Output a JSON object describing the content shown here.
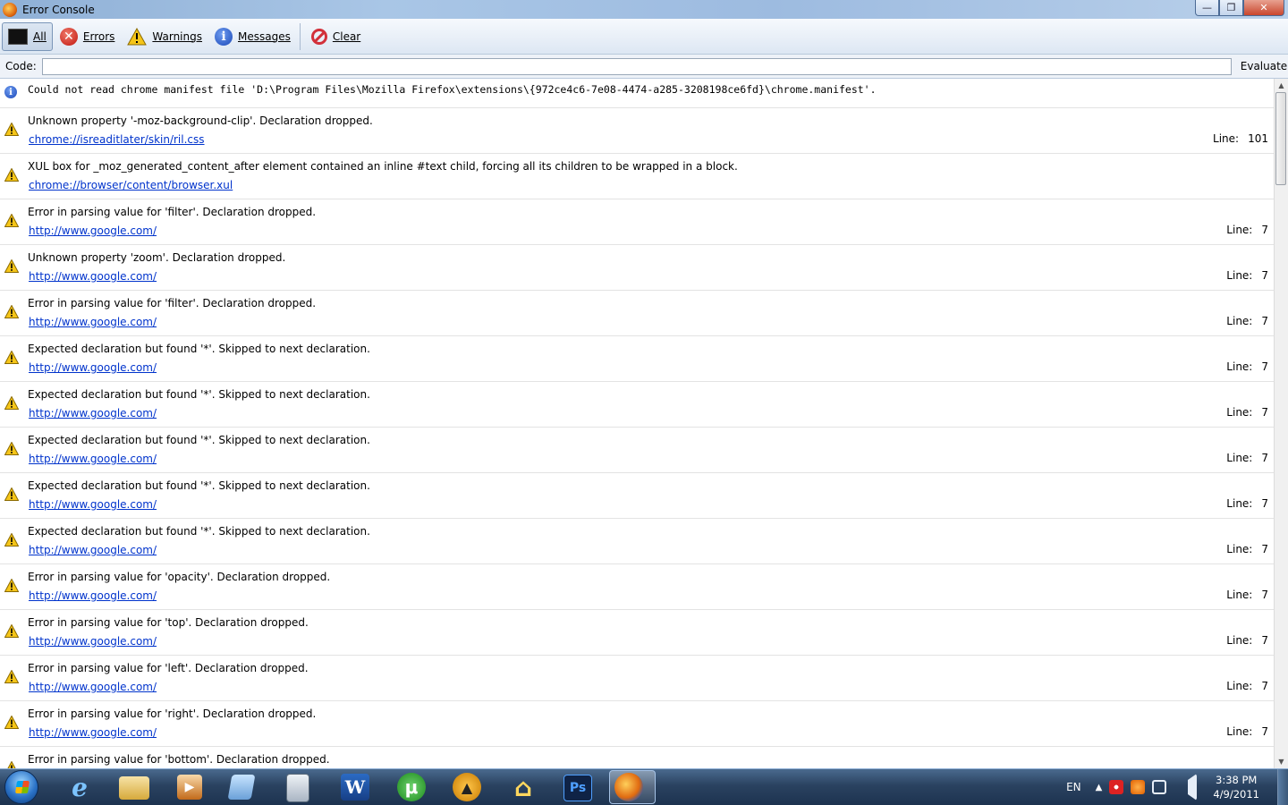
{
  "window": {
    "title": "Error Console"
  },
  "toolbar": {
    "all_label": "All",
    "errors_label": "Errors",
    "warnings_label": "Warnings",
    "messages_label": "Messages",
    "clear_label": "Clear"
  },
  "codebar": {
    "label": "Code:",
    "value": "",
    "evaluate_label": "Evaluate"
  },
  "messages": [
    {
      "type": "info",
      "text": "Could not read chrome manifest file 'D:\\Program Files\\Mozilla Firefox\\extensions\\{972ce4c6-7e08-4474-a285-3208198ce6fd}\\chrome.manifest'.",
      "source": "",
      "line_label": "",
      "line": ""
    },
    {
      "type": "warning",
      "text": "Unknown property '-moz-background-clip'.  Declaration dropped.",
      "source": "chrome://isreaditlater/skin/ril.css",
      "line_label": "Line:",
      "line": "101"
    },
    {
      "type": "warning",
      "text": "XUL box for _moz_generated_content_after element contained an inline #text child, forcing all its children to be wrapped in a block.",
      "source": "chrome://browser/content/browser.xul",
      "line_label": "",
      "line": ""
    },
    {
      "type": "warning",
      "text": "Error in parsing value for 'filter'.  Declaration dropped.",
      "source": "http://www.google.com/",
      "line_label": "Line:",
      "line": "7"
    },
    {
      "type": "warning",
      "text": "Unknown property 'zoom'.  Declaration dropped.",
      "source": "http://www.google.com/",
      "line_label": "Line:",
      "line": "7"
    },
    {
      "type": "warning",
      "text": "Error in parsing value for 'filter'.  Declaration dropped.",
      "source": "http://www.google.com/",
      "line_label": "Line:",
      "line": "7"
    },
    {
      "type": "warning",
      "text": "Expected declaration but found '*'.  Skipped to next declaration.",
      "source": "http://www.google.com/",
      "line_label": "Line:",
      "line": "7"
    },
    {
      "type": "warning",
      "text": "Expected declaration but found '*'.  Skipped to next declaration.",
      "source": "http://www.google.com/",
      "line_label": "Line:",
      "line": "7"
    },
    {
      "type": "warning",
      "text": "Expected declaration but found '*'.  Skipped to next declaration.",
      "source": "http://www.google.com/",
      "line_label": "Line:",
      "line": "7"
    },
    {
      "type": "warning",
      "text": "Expected declaration but found '*'.  Skipped to next declaration.",
      "source": "http://www.google.com/",
      "line_label": "Line:",
      "line": "7"
    },
    {
      "type": "warning",
      "text": "Expected declaration but found '*'.  Skipped to next declaration.",
      "source": "http://www.google.com/",
      "line_label": "Line:",
      "line": "7"
    },
    {
      "type": "warning",
      "text": "Error in parsing value for 'opacity'.  Declaration dropped.",
      "source": "http://www.google.com/",
      "line_label": "Line:",
      "line": "7"
    },
    {
      "type": "warning",
      "text": "Error in parsing value for 'top'.  Declaration dropped.",
      "source": "http://www.google.com/",
      "line_label": "Line:",
      "line": "7"
    },
    {
      "type": "warning",
      "text": "Error in parsing value for 'left'.  Declaration dropped.",
      "source": "http://www.google.com/",
      "line_label": "Line:",
      "line": "7"
    },
    {
      "type": "warning",
      "text": "Error in parsing value for 'right'.  Declaration dropped.",
      "source": "http://www.google.com/",
      "line_label": "Line:",
      "line": "7"
    },
    {
      "type": "warning",
      "text": "Error in parsing value for 'bottom'.  Declaration dropped.",
      "source": "",
      "line_label": "",
      "line": ""
    }
  ],
  "taskbar": {
    "apps": [
      "internet-explorer-icon",
      "folder-icon",
      "media-player-icon",
      "notes-icon",
      "calculator-icon",
      "word-icon",
      "utorrent-icon",
      "aimp-icon",
      "home-icon",
      "photoshop-icon",
      "firefox-icon"
    ],
    "word_glyph": "W",
    "ps_glyph": "Ps",
    "language": "EN",
    "time": "3:38 PM",
    "date": "4/9/2011"
  },
  "colors": {
    "link": "#0033cc",
    "warning": "#f5c518",
    "error": "#c0140c",
    "info": "#1a48b8",
    "taskbar": "#2a4260"
  }
}
